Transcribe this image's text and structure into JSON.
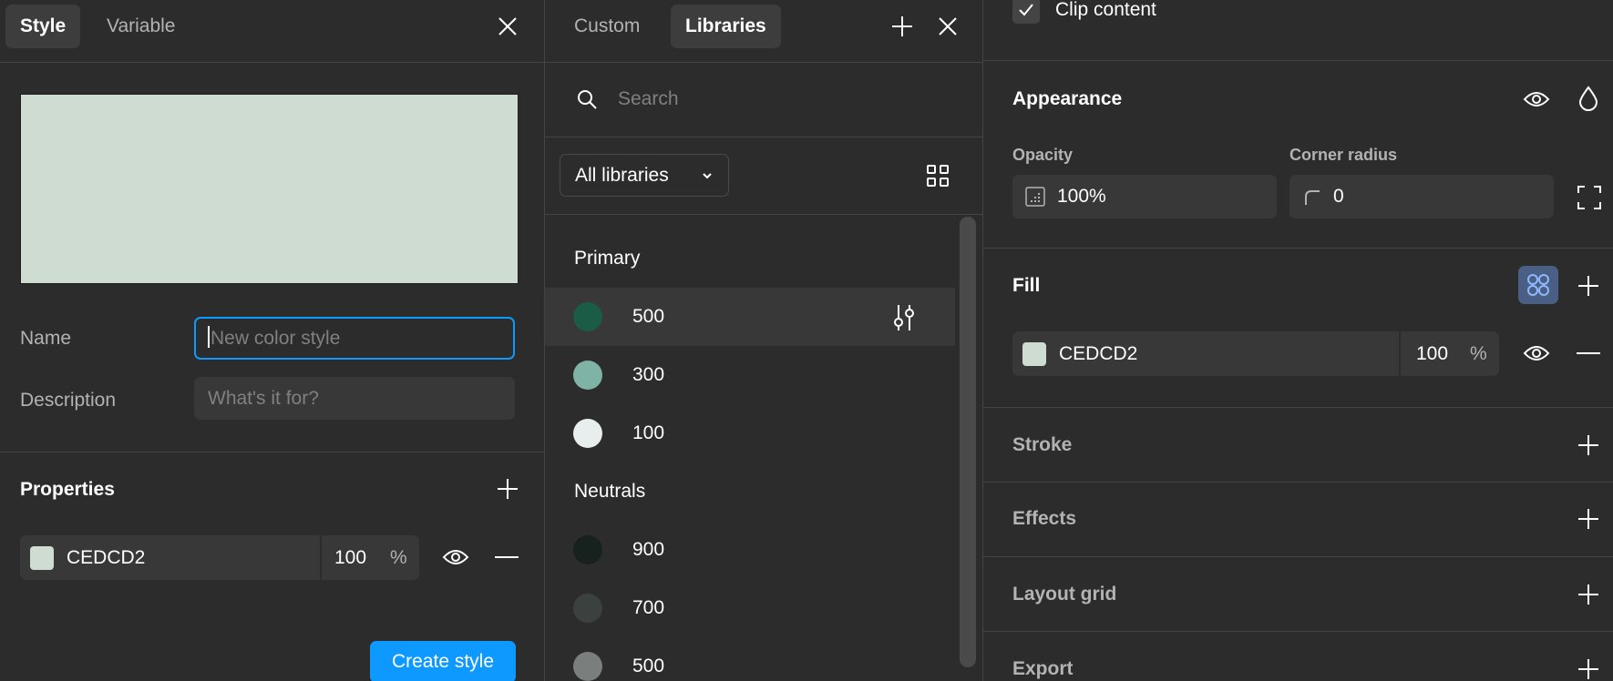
{
  "style_panel": {
    "tabs": [
      {
        "label": "Style",
        "active": true
      },
      {
        "label": "Variable",
        "active": false
      }
    ],
    "preview_color": "#cedcd2",
    "name_label": "Name",
    "name_placeholder": "New color style",
    "description_label": "Description",
    "description_placeholder": "What's it for?",
    "properties_title": "Properties",
    "property": {
      "hex": "CEDCD2",
      "opacity": "100",
      "unit": "%",
      "color": "#cedcd2"
    },
    "create_button": "Create style"
  },
  "libraries_panel": {
    "tabs": [
      {
        "label": "Custom",
        "active": false
      },
      {
        "label": "Libraries",
        "active": true
      }
    ],
    "search_placeholder": "Search",
    "filter_value": "All libraries",
    "groups": [
      {
        "title": "Primary",
        "items": [
          {
            "label": "500",
            "color": "#1a5c45"
          },
          {
            "label": "300",
            "color": "#7fb3a6"
          },
          {
            "label": "100",
            "color": "#e8eeed"
          }
        ]
      },
      {
        "title": "Neutrals",
        "items": [
          {
            "label": "900",
            "color": "#17211e"
          },
          {
            "label": "700",
            "color": "#3a413f"
          },
          {
            "label": "500",
            "color": "#7a7e7d"
          }
        ]
      }
    ]
  },
  "properties_panel": {
    "clip_content_label": "Clip content",
    "clip_content_checked": true,
    "appearance_title": "Appearance",
    "opacity_label": "Opacity",
    "opacity_value": "100%",
    "corner_radius_label": "Corner radius",
    "corner_radius_value": "0",
    "fill_title": "Fill",
    "fill": {
      "hex": "CEDCD2",
      "opacity": "100",
      "unit": "%",
      "color": "#cedcd2"
    },
    "stroke_title": "Stroke",
    "effects_title": "Effects",
    "layout_grid_title": "Layout grid",
    "export_title": "Export"
  },
  "accent_color": "#0d99ff"
}
